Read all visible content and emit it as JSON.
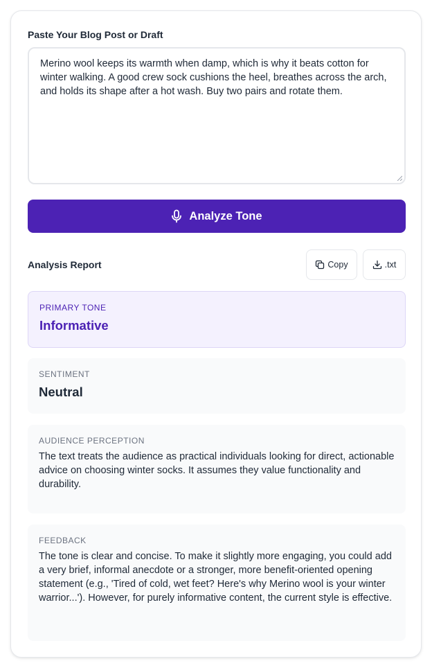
{
  "input": {
    "label": "Paste Your Blog Post or Draft",
    "value": "Merino wool keeps its warmth when damp, which is why it beats cotton for winter walking. A good crew sock cushions the heel, breathes across the arch, and holds its shape after a hot wash. Buy two pairs and rotate them."
  },
  "analyze_button": {
    "label": "Analyze Tone",
    "icon": "microphone-icon"
  },
  "report": {
    "title": "Analysis Report",
    "copy_label": "Copy",
    "download_label": ".txt",
    "primary_tone": {
      "label": "PRIMARY TONE",
      "value": "Informative"
    },
    "sentiment": {
      "label": "SENTIMENT",
      "value": "Neutral"
    },
    "audience": {
      "label": "AUDIENCE PERCEPTION",
      "text": "The text treats the audience as practical individuals looking for direct, actionable advice on choosing winter socks. It assumes they value functionality and durability."
    },
    "feedback": {
      "label": "FEEDBACK",
      "text": "The tone is clear and concise. To make it slightly more engaging, you could add a very brief, informal anecdote or a stronger, more benefit-oriented opening statement (e.g., 'Tired of cold, wet feet? Here's why Merino wool is your winter warrior...'). However, for purely informative content, the current style is effective."
    }
  },
  "colors": {
    "accent": "#4c22b4",
    "primary_panel_bg": "#f4f1fe",
    "panel_bg": "#f9fafb"
  }
}
